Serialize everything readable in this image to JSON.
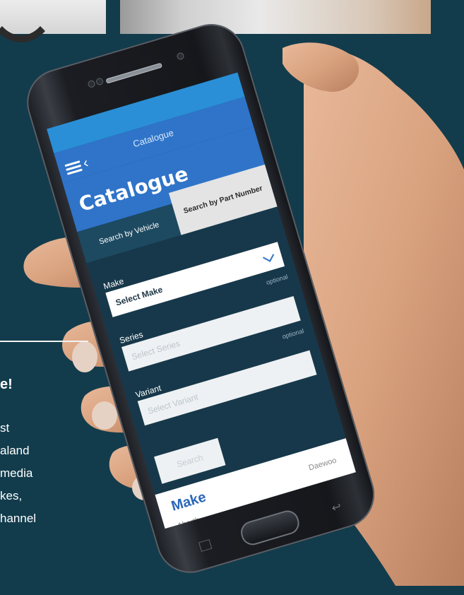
{
  "article": {
    "headline_fragment": "e!",
    "lines": [
      "st",
      "aland",
      "media",
      "kes,",
      "hannel"
    ]
  },
  "phone": {
    "status_bar_title": "Catalogue",
    "page_title": "Catalogue",
    "tabs": {
      "search_by_vehicle": "Search by Vehicle",
      "search_by_part_number": "Search by Part Number"
    },
    "fields": {
      "make_label": "Make",
      "make_value": "Select Make",
      "series_label": "Series",
      "series_placeholder": "Select Series",
      "series_optional": "optional",
      "variant_label": "Variant",
      "variant_placeholder": "Select Variant",
      "variant_optional": "optional"
    },
    "search_button": "Search",
    "sheet": {
      "title": "Make",
      "right_item": "Daewoo",
      "first_item": "Abarth"
    }
  },
  "colors": {
    "background": "#123c4c",
    "app_blue": "#2f74c8",
    "status_blue": "#2a8fd6"
  }
}
